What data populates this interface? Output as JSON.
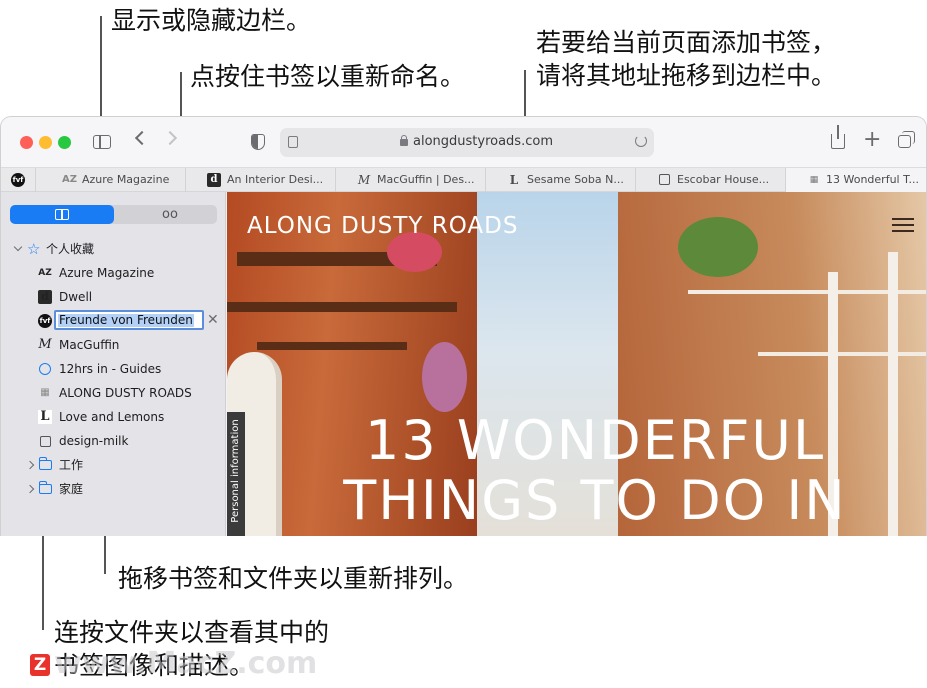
{
  "callouts": {
    "show_hide_sidebar": "显示或隐藏边栏。",
    "rename_bookmark": "点按住书签以重新命名。",
    "add_bookmark_line1": "若要给当前页面添加书签，",
    "add_bookmark_line2": "请将其地址拖移到边栏中。",
    "rearrange": "拖移书签和文件夹以重新排列。",
    "view_folder_line1": "连按文件夹以查看其中的",
    "view_folder_line2": "书签图像和描述。"
  },
  "toolbar": {
    "address": "alongdustyroads.com"
  },
  "tabs": [
    {
      "favicon": "AZ",
      "label": "Azure Magazine"
    },
    {
      "favicon": "d",
      "label": "An Interior Desi..."
    },
    {
      "favicon": "M",
      "label": "MacGuffin | Des..."
    },
    {
      "favicon": "L",
      "label": "Sesame Soba N..."
    },
    {
      "favicon": "bag-icon",
      "label": "Escobar House..."
    },
    {
      "favicon": "grid-icon",
      "label": "13 Wonderful T..."
    }
  ],
  "sidebar": {
    "favorites_label": "个人收藏",
    "bookmarks": [
      {
        "favicon": "AZ",
        "label": "Azure Magazine"
      },
      {
        "favicon": "d",
        "label": "Dwell"
      },
      {
        "favicon": "fvf",
        "label": "Freunde von Freunden",
        "editing": true
      },
      {
        "favicon": "M",
        "label": "MacGuffin"
      },
      {
        "favicon": "globe-icon",
        "label": "12hrs in - Guides"
      },
      {
        "favicon": "grid-icon",
        "label": "ALONG DUSTY ROADS"
      },
      {
        "favicon": "L",
        "label": "Love and Lemons"
      },
      {
        "favicon": "bag-icon",
        "label": "design-milk"
      }
    ],
    "folders": [
      {
        "label": "工作"
      },
      {
        "label": "家庭"
      }
    ]
  },
  "content": {
    "site_logo": "ALONG DUSTY ROADS",
    "headline_line1": "13 WONDERFUL",
    "headline_line2": "THINGS TO DO IN",
    "side_tab": "Personal information"
  },
  "watermark": "www.MacZ.com",
  "colors": {
    "accent": "#1a7cf5",
    "close": "#fe5f57",
    "minimize": "#febc2e",
    "zoom": "#28c840"
  }
}
